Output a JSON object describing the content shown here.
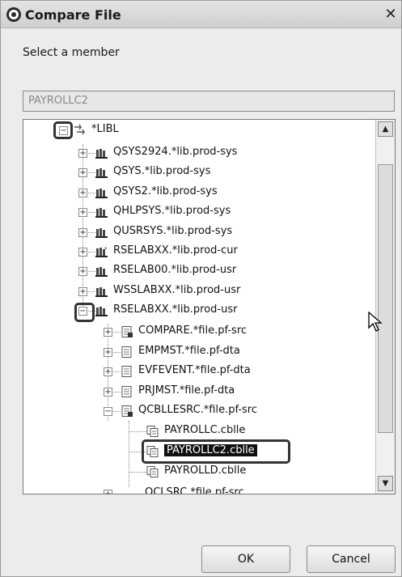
{
  "window": {
    "title": "Compare File",
    "close_label": "✕"
  },
  "prompt": "Select a member",
  "member_field": {
    "value": "PAYROLLC2"
  },
  "tree": {
    "root": {
      "label": "*LIBL"
    },
    "libraries": [
      {
        "label": "QSYS2924.*lib.prod-sys",
        "icon": "library-icon"
      },
      {
        "label": "QSYS.*lib.prod-sys",
        "icon": "library-icon"
      },
      {
        "label": "QSYS2.*lib.prod-sys",
        "icon": "library-icon"
      },
      {
        "label": "QHLPSYS.*lib.prod-sys",
        "icon": "library-icon"
      },
      {
        "label": "QUSRSYS.*lib.prod-sys",
        "icon": "library-icon"
      },
      {
        "label": "RSELABXX.*lib.prod-cur",
        "icon": "current-library-icon"
      },
      {
        "label": "RSELAB00.*lib.prod-usr",
        "icon": "library-icon"
      },
      {
        "label": "WSSLABXX.*lib.prod-usr",
        "icon": "library-icon"
      },
      {
        "label": "RSELABXX.*lib.prod-usr",
        "icon": "library-icon"
      }
    ],
    "files": [
      {
        "label": "COMPARE.*file.pf-src",
        "icon": "source-file-icon"
      },
      {
        "label": "EMPMST.*file.pf-dta",
        "icon": "data-file-icon"
      },
      {
        "label": "EVFEVENT.*file.pf-dta",
        "icon": "data-file-icon"
      },
      {
        "label": "PRJMST.*file.pf-dta",
        "icon": "data-file-icon"
      },
      {
        "label": "QCBLLESRC.*file.pf-src",
        "icon": "source-file-icon"
      }
    ],
    "members": [
      {
        "label": "PAYROLLC.cblle",
        "icon": "member-icon"
      },
      {
        "label": "PAYROLLC2.cblle",
        "icon": "member-icon",
        "selected": true
      },
      {
        "label": "PAYROLLD.cblle",
        "icon": "member-icon"
      }
    ],
    "partial_row": {
      "label": "QCLSRC.*file.pf-src"
    }
  },
  "buttons": {
    "ok": "OK",
    "cancel": "Cancel"
  }
}
